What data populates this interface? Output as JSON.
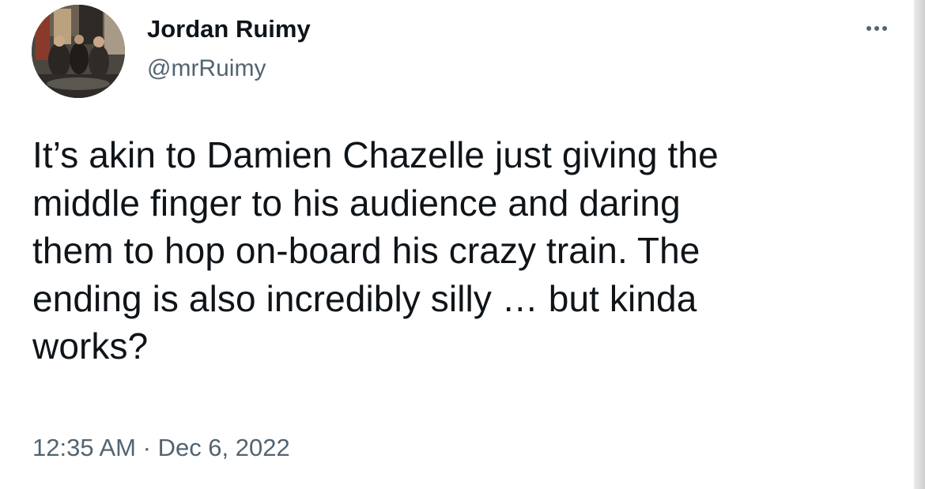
{
  "tweet": {
    "author": {
      "name": "Jordan Ruimy",
      "handle": "@mrRuimy"
    },
    "text": "It’s akin to Damien Chazelle just giving the\nmiddle finger to his audience and daring\nthem to hop on-board his crazy train. The\nending is also incredibly silly … but kinda\nworks?",
    "time": "12:35 AM",
    "separator": "·",
    "date": "Dec 6, 2022"
  },
  "icons": {
    "more": "more-horizontal-icon"
  },
  "colors": {
    "primary_text": "#0f1419",
    "secondary_text": "#536471",
    "background": "#ffffff"
  }
}
